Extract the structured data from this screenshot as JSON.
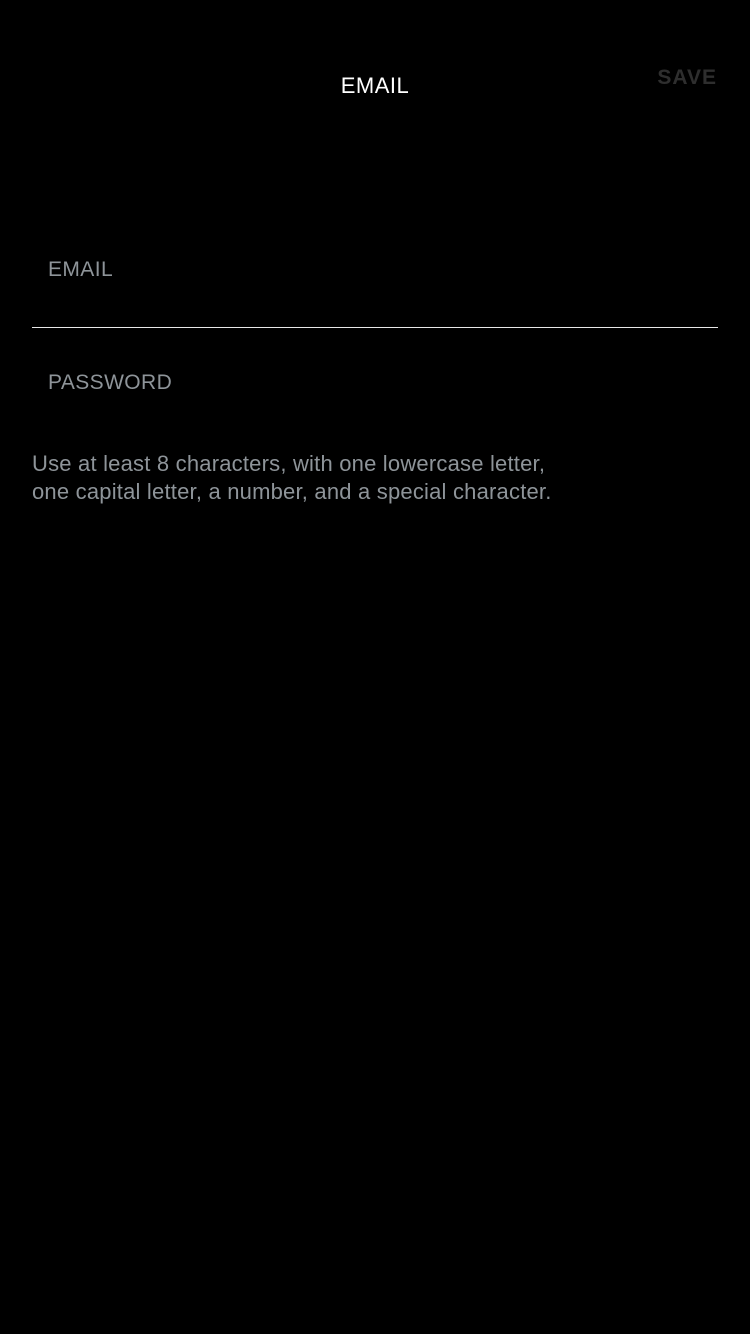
{
  "nav": {
    "title": "EMAIL",
    "save_label": "SAVE"
  },
  "form": {
    "email": {
      "placeholder": "EMAIL",
      "value": ""
    },
    "password": {
      "placeholder": "PASSWORD",
      "value": ""
    },
    "hint_lines": [
      "Use at least 8 characters, with one lowercase letter,",
      "one capital letter, a number, and a special character."
    ]
  },
  "colors": {
    "background": "#000000",
    "title": "#ffffff",
    "save_disabled": "#2e2e2e",
    "placeholder": "#8e9499",
    "divider": "#e8e8e8"
  }
}
